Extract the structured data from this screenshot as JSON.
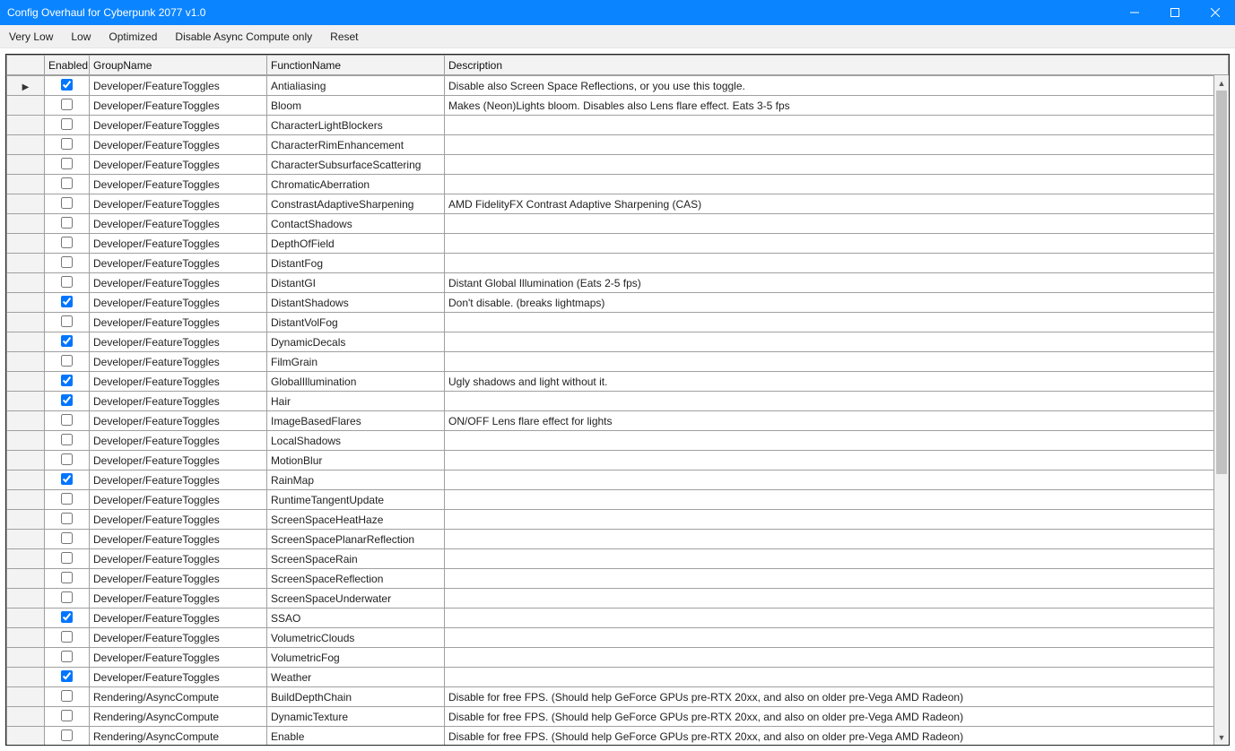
{
  "window": {
    "title": "Config Overhaul for Cyberpunk 2077 v1.0"
  },
  "toolbar": {
    "very_low": "Very Low",
    "low": "Low",
    "optimized": "Optimized",
    "disable_async": "Disable Async Compute only",
    "reset": "Reset"
  },
  "columns": {
    "enabled": "Enabled",
    "group": "GroupName",
    "func": "FunctionName",
    "desc": "Description"
  },
  "rows": [
    {
      "indicator": "▶",
      "enabled": true,
      "group": "Developer/FeatureToggles",
      "func": "Antialiasing",
      "desc": "Disable also Screen Space Reflections, or you use this toggle."
    },
    {
      "indicator": "",
      "enabled": false,
      "group": "Developer/FeatureToggles",
      "func": "Bloom",
      "desc": "Makes (Neon)Lights bloom. Disables also Lens flare effect. Eats 3-5 fps"
    },
    {
      "indicator": "",
      "enabled": false,
      "group": "Developer/FeatureToggles",
      "func": "CharacterLightBlockers",
      "desc": ""
    },
    {
      "indicator": "",
      "enabled": false,
      "group": "Developer/FeatureToggles",
      "func": "CharacterRimEnhancement",
      "desc": ""
    },
    {
      "indicator": "",
      "enabled": false,
      "group": "Developer/FeatureToggles",
      "func": "CharacterSubsurfaceScattering",
      "desc": ""
    },
    {
      "indicator": "",
      "enabled": false,
      "group": "Developer/FeatureToggles",
      "func": "ChromaticAberration",
      "desc": ""
    },
    {
      "indicator": "",
      "enabled": false,
      "group": "Developer/FeatureToggles",
      "func": "ConstrastAdaptiveSharpening",
      "desc": "AMD FidelityFX Contrast Adaptive Sharpening (CAS)"
    },
    {
      "indicator": "",
      "enabled": false,
      "group": "Developer/FeatureToggles",
      "func": "ContactShadows",
      "desc": ""
    },
    {
      "indicator": "",
      "enabled": false,
      "group": "Developer/FeatureToggles",
      "func": "DepthOfField",
      "desc": ""
    },
    {
      "indicator": "",
      "enabled": false,
      "group": "Developer/FeatureToggles",
      "func": "DistantFog",
      "desc": ""
    },
    {
      "indicator": "",
      "enabled": false,
      "group": "Developer/FeatureToggles",
      "func": "DistantGI",
      "desc": "Distant Global Illumination (Eats 2-5 fps)"
    },
    {
      "indicator": "",
      "enabled": true,
      "group": "Developer/FeatureToggles",
      "func": "DistantShadows",
      "desc": "Don't disable. (breaks lightmaps)"
    },
    {
      "indicator": "",
      "enabled": false,
      "group": "Developer/FeatureToggles",
      "func": "DistantVolFog",
      "desc": ""
    },
    {
      "indicator": "",
      "enabled": true,
      "group": "Developer/FeatureToggles",
      "func": "DynamicDecals",
      "desc": ""
    },
    {
      "indicator": "",
      "enabled": false,
      "group": "Developer/FeatureToggles",
      "func": "FilmGrain",
      "desc": ""
    },
    {
      "indicator": "",
      "enabled": true,
      "group": "Developer/FeatureToggles",
      "func": "GlobalIllumination",
      "desc": "Ugly shadows and light without it."
    },
    {
      "indicator": "",
      "enabled": true,
      "group": "Developer/FeatureToggles",
      "func": "Hair",
      "desc": ""
    },
    {
      "indicator": "",
      "enabled": false,
      "group": "Developer/FeatureToggles",
      "func": "ImageBasedFlares",
      "desc": "ON/OFF Lens flare effect for lights"
    },
    {
      "indicator": "",
      "enabled": false,
      "group": "Developer/FeatureToggles",
      "func": "LocalShadows",
      "desc": ""
    },
    {
      "indicator": "",
      "enabled": false,
      "group": "Developer/FeatureToggles",
      "func": "MotionBlur",
      "desc": ""
    },
    {
      "indicator": "",
      "enabled": true,
      "group": "Developer/FeatureToggles",
      "func": "RainMap",
      "desc": ""
    },
    {
      "indicator": "",
      "enabled": false,
      "group": "Developer/FeatureToggles",
      "func": "RuntimeTangentUpdate",
      "desc": ""
    },
    {
      "indicator": "",
      "enabled": false,
      "group": "Developer/FeatureToggles",
      "func": "ScreenSpaceHeatHaze",
      "desc": ""
    },
    {
      "indicator": "",
      "enabled": false,
      "group": "Developer/FeatureToggles",
      "func": "ScreenSpacePlanarReflection",
      "desc": ""
    },
    {
      "indicator": "",
      "enabled": false,
      "group": "Developer/FeatureToggles",
      "func": "ScreenSpaceRain",
      "desc": ""
    },
    {
      "indicator": "",
      "enabled": false,
      "group": "Developer/FeatureToggles",
      "func": "ScreenSpaceReflection",
      "desc": ""
    },
    {
      "indicator": "",
      "enabled": false,
      "group": "Developer/FeatureToggles",
      "func": "ScreenSpaceUnderwater",
      "desc": ""
    },
    {
      "indicator": "",
      "enabled": true,
      "group": "Developer/FeatureToggles",
      "func": "SSAO",
      "desc": ""
    },
    {
      "indicator": "",
      "enabled": false,
      "group": "Developer/FeatureToggles",
      "func": "VolumetricClouds",
      "desc": ""
    },
    {
      "indicator": "",
      "enabled": false,
      "group": "Developer/FeatureToggles",
      "func": "VolumetricFog",
      "desc": ""
    },
    {
      "indicator": "",
      "enabled": true,
      "group": "Developer/FeatureToggles",
      "func": "Weather",
      "desc": ""
    },
    {
      "indicator": "",
      "enabled": false,
      "group": "Rendering/AsyncCompute",
      "func": "BuildDepthChain",
      "desc": "Disable for free FPS. (Should help GeForce GPUs pre-RTX 20xx, and also on older pre-Vega AMD Radeon)"
    },
    {
      "indicator": "",
      "enabled": false,
      "group": "Rendering/AsyncCompute",
      "func": "DynamicTexture",
      "desc": "Disable for free FPS. (Should help GeForce GPUs pre-RTX 20xx, and also on older pre-Vega AMD Radeon)"
    },
    {
      "indicator": "",
      "enabled": false,
      "group": "Rendering/AsyncCompute",
      "func": "Enable",
      "desc": "Disable for free FPS. (Should help GeForce GPUs pre-RTX 20xx, and also on older pre-Vega AMD Radeon)"
    }
  ]
}
